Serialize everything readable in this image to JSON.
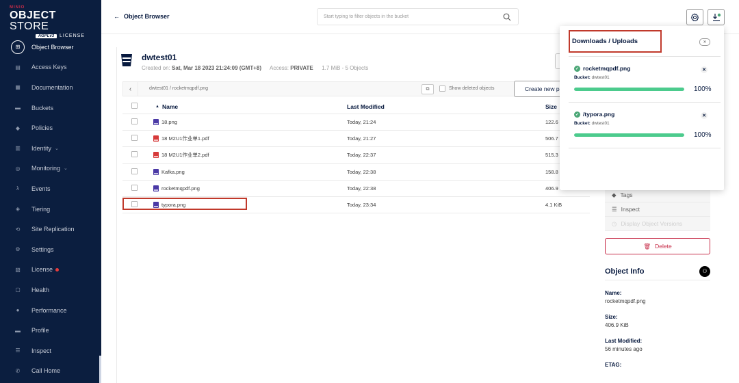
{
  "brand": {
    "minio": "MINIO",
    "title_bold": "OBJECT",
    "title_light": "STORE",
    "license_badge": "AGPLv3",
    "license_word": "LICENSE"
  },
  "sidebar": {
    "items": [
      {
        "label": "Object Browser",
        "icon": "folder-icon",
        "active": true
      },
      {
        "label": "Access Keys",
        "icon": "key-icon"
      },
      {
        "label": "Documentation",
        "icon": "docs-icon"
      },
      {
        "label": "Buckets",
        "icon": "bucket-icon"
      },
      {
        "label": "Policies",
        "icon": "shield-icon"
      },
      {
        "label": "Identity",
        "icon": "id-card-icon",
        "expand": true
      },
      {
        "label": "Monitoring",
        "icon": "search-icon",
        "expand": true
      },
      {
        "label": "Events",
        "icon": "lambda-icon"
      },
      {
        "label": "Tiering",
        "icon": "tiers-icon"
      },
      {
        "label": "Site Replication",
        "icon": "sync-icon"
      },
      {
        "label": "Settings",
        "icon": "gear-icon"
      },
      {
        "label": "License",
        "icon": "license-icon",
        "dot": true
      },
      {
        "label": "Health",
        "icon": "health-icon"
      },
      {
        "label": "Performance",
        "icon": "speed-icon"
      },
      {
        "label": "Profile",
        "icon": "profile-icon"
      },
      {
        "label": "Inspect",
        "icon": "inspect-icon"
      },
      {
        "label": "Call Home",
        "icon": "phone-icon"
      }
    ]
  },
  "topbar": {
    "back_label": "Object Browser",
    "search_placeholder": "Start typing to filter objects in the bucket"
  },
  "bucket": {
    "name": "dwtest01",
    "created_label": "Created on:",
    "created_value": "Sat, Mar 18 2023 21:24:09 (GMT+8)",
    "access_label": "Access:",
    "access_value": "PRIVATE",
    "stats": "1.7 MiB - 5 Objects"
  },
  "crumb": {
    "path": "dwtest01 / rocketmqpdf.png",
    "show_deleted": "Show deleted objects",
    "new_path_label": "Create new path"
  },
  "table": {
    "headers": {
      "name": "Name",
      "modified": "Last Modified",
      "size": "Size"
    },
    "rows": [
      {
        "name": "18.png",
        "type": "png",
        "modified": "Today, 21:24",
        "size": "122.6"
      },
      {
        "name": "18 M2U1作业单1.pdf",
        "type": "pdf",
        "modified": "Today, 21:27",
        "size": "506.7"
      },
      {
        "name": "18 M2U1作业单2.pdf",
        "type": "pdf",
        "modified": "Today, 22:37",
        "size": "515.3"
      },
      {
        "name": "Kafka.png",
        "type": "png",
        "modified": "Today, 22:38",
        "size": "158.8"
      },
      {
        "name": "rocketmqpdf.png",
        "type": "png",
        "modified": "Today, 22:38",
        "size": "406.9 KiB"
      },
      {
        "name": "typora.png",
        "type": "png",
        "modified": "Today, 23:34",
        "size": "4.1 KiB",
        "highlight": true
      }
    ]
  },
  "object_panel": {
    "actions": [
      {
        "label": "Tags",
        "icon": "tag-icon"
      },
      {
        "label": "Inspect",
        "icon": "inspect-icon"
      },
      {
        "label": "Display Object Versions",
        "icon": "versions-icon",
        "disabled": true
      }
    ],
    "delete_label": "Delete",
    "info_title": "Object Info",
    "fields": [
      {
        "label": "Name:",
        "value": "rocketmqpdf.png"
      },
      {
        "label": "Size:",
        "value": "406.9 KiB"
      },
      {
        "label": "Last Modified:",
        "value": "56 minutes ago"
      },
      {
        "label": "ETAG:",
        "value": ""
      }
    ]
  },
  "transfers": {
    "title": "Downloads / Uploads",
    "items": [
      {
        "name": "rocketmqpdf.png",
        "bucket_label": "Bucket:",
        "bucket": "dwtest01",
        "progress": 100,
        "percent_text": "100%"
      },
      {
        "name": "/typora.png",
        "bucket_label": "Bucket:",
        "bucket": "dwtest01",
        "progress": 100,
        "percent_text": "100%"
      }
    ]
  },
  "colors": {
    "sidebar_bg": "#0b1e3f",
    "accent_red": "#c72c48",
    "progress_green": "#4ccb8d",
    "highlight_box": "#c0392b"
  }
}
